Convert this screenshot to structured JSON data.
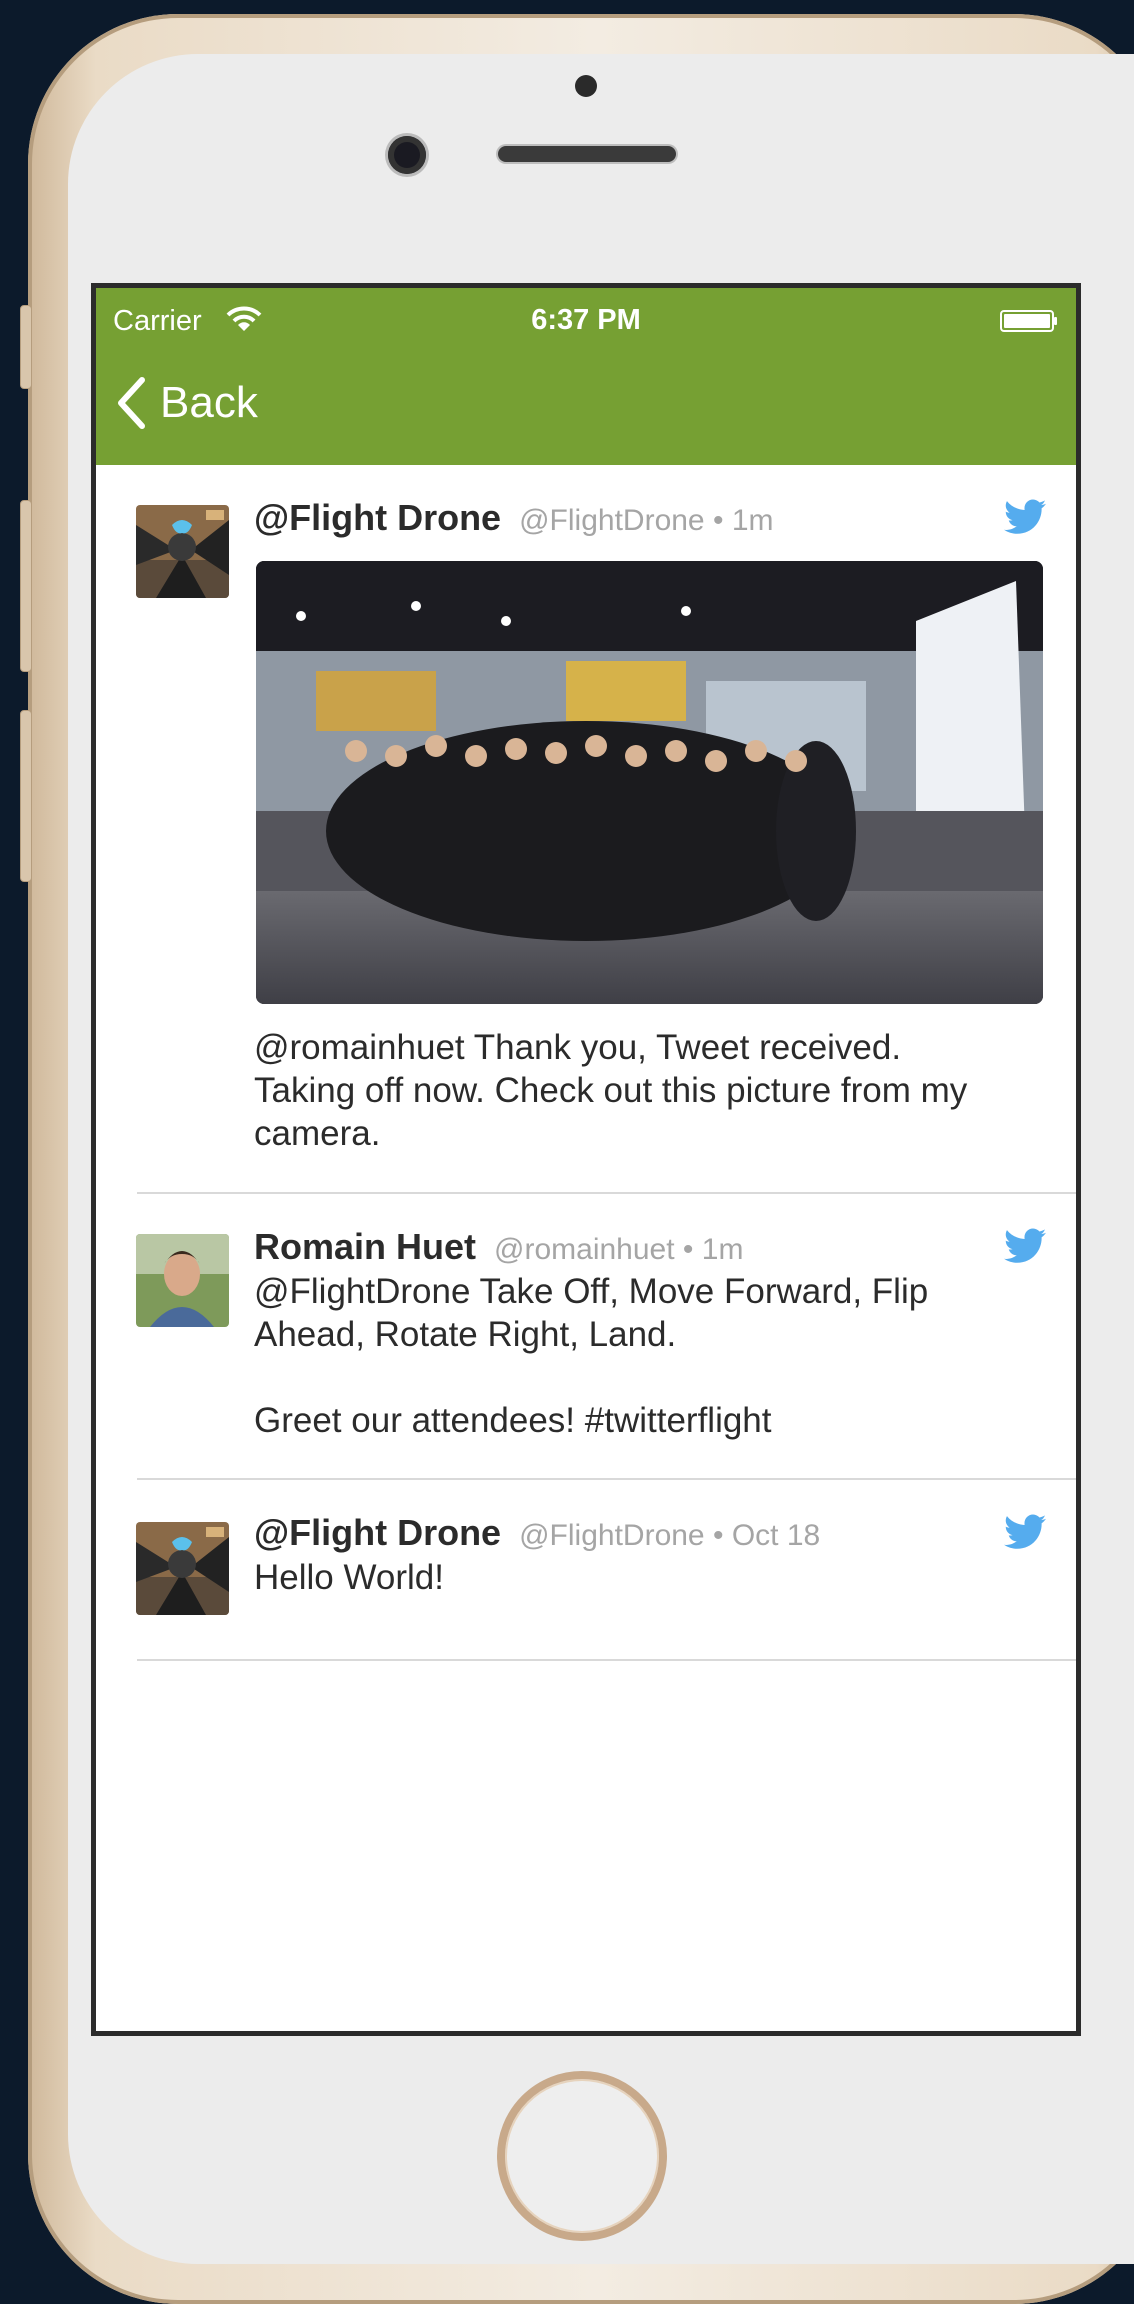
{
  "status_bar": {
    "carrier": "Carrier",
    "time": "6:37 PM"
  },
  "nav": {
    "back_label": "Back",
    "bar_color": "#76a033"
  },
  "tweets": [
    {
      "author": "@Flight Drone",
      "handle": "@FlightDrone",
      "time": "1m",
      "text": "@romainhuet Thank you, Tweet received.\nTaking off now. Check out this picture from my\ncamera.",
      "has_media": true,
      "avatar": "drone-avatar"
    },
    {
      "author": "Romain Huet",
      "handle": "@romainhuet",
      "time": "1m",
      "text": "@FlightDrone Take Off, Move Forward, Flip\nAhead, Rotate Right, Land.\n\nGreet our attendees! #twitterflight",
      "has_media": false,
      "avatar": "person-avatar"
    },
    {
      "author": "@Flight Drone",
      "handle": "@FlightDrone",
      "time": "Oct 18",
      "text": "Hello World!",
      "has_media": false,
      "avatar": "drone-avatar"
    }
  ],
  "icons": {
    "tweet_brand": "twitter-bird-icon",
    "brand_color": "#55acee"
  }
}
